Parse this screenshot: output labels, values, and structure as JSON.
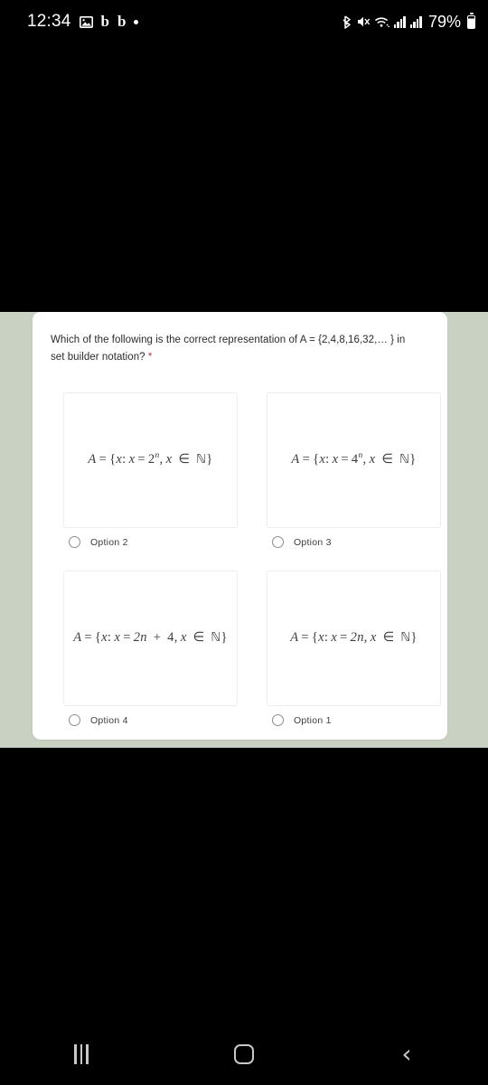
{
  "status_bar": {
    "time": "12:34",
    "left_icons": [
      {
        "name": "gallery-icon",
        "glyph": "ὛB"
      },
      {
        "name": "app-badge-b-1",
        "glyph": "b"
      },
      {
        "name": "app-badge-b-2",
        "glyph": "b"
      },
      {
        "name": "more-dot-icon",
        "glyph": "•"
      }
    ],
    "right_icons": [
      {
        "name": "bluetooth-icon",
        "glyph": "Д"
      },
      {
        "name": "mute-icon",
        "glyph": "Д"
      },
      {
        "name": "wifi-icon",
        "glyph": "Д"
      },
      {
        "name": "signal-sim1-icon",
        "glyph": "bars"
      },
      {
        "name": "signal-sim2-icon",
        "glyph": "bars"
      }
    ],
    "battery_percent": "79%",
    "battery_level": 79
  },
  "form": {
    "question": "Which of the following is the correct representation of A = {2,4,8,16,32,… } in set builder notation?",
    "required_marker": "*",
    "options": [
      {
        "id": "opt-a",
        "formula_text": "A = {x: x = 2ⁿ, x ∈ ℕ}",
        "label": "Option 2",
        "selected": false,
        "formula_parts": {
          "lhs": "A",
          "eq": "=",
          "brace_open": "{",
          "var1": "x",
          "colon": ":",
          "var2": "x",
          "eq2": "=",
          "base": "2",
          "exponent": "n",
          "comma": ",",
          "var3": "x",
          "member": "∈",
          "set": "ℕ",
          "brace_close": "}"
        }
      },
      {
        "id": "opt-b",
        "formula_text": "A = {x: x = 4ⁿ, x ∈ ℕ}",
        "label": "Option 3",
        "selected": false,
        "formula_parts": {
          "lhs": "A",
          "eq": "=",
          "brace_open": "{",
          "var1": "x",
          "colon": ":",
          "var2": "x",
          "eq2": "=",
          "base": "4",
          "exponent": "n",
          "comma": ",",
          "var3": "x",
          "member": "∈",
          "set": "ℕ",
          "brace_close": "}"
        }
      },
      {
        "id": "opt-c",
        "formula_text": "A = {x: x = 2n + 4, x ∈ ℕ}",
        "label": "Option 4",
        "selected": false,
        "formula_parts": {
          "lhs": "A",
          "eq": "=",
          "brace_open": "{",
          "var1": "x",
          "colon": ":",
          "var2": "x",
          "eq2": "=",
          "coef": "2n",
          "plus": "+",
          "const": "4",
          "comma": ",",
          "var3": "x",
          "member": "∈",
          "set": "ℕ",
          "brace_close": "}"
        }
      },
      {
        "id": "opt-d",
        "formula_text": "A = {x: x = 2n, x ∈ ℕ}",
        "label": "Option 1",
        "selected": false,
        "formula_parts": {
          "lhs": "A",
          "eq": "=",
          "brace_open": "{",
          "var1": "x",
          "colon": ":",
          "var2": "x",
          "eq2": "=",
          "coef": "2n",
          "comma": ",",
          "var3": "x",
          "member": "∈",
          "set": "ℕ",
          "brace_close": "}"
        }
      }
    ]
  },
  "nav_bar": {
    "recents_label": "Recents",
    "home_label": "Home",
    "back_label": "Back",
    "back_glyph": "‹"
  },
  "colors": {
    "page_background": "#c9d2c2",
    "card_background": "#ffffff",
    "letterbox": "#000000",
    "required_asterisk": "#b33a3a",
    "radio_outline": "#8d8d8d"
  }
}
